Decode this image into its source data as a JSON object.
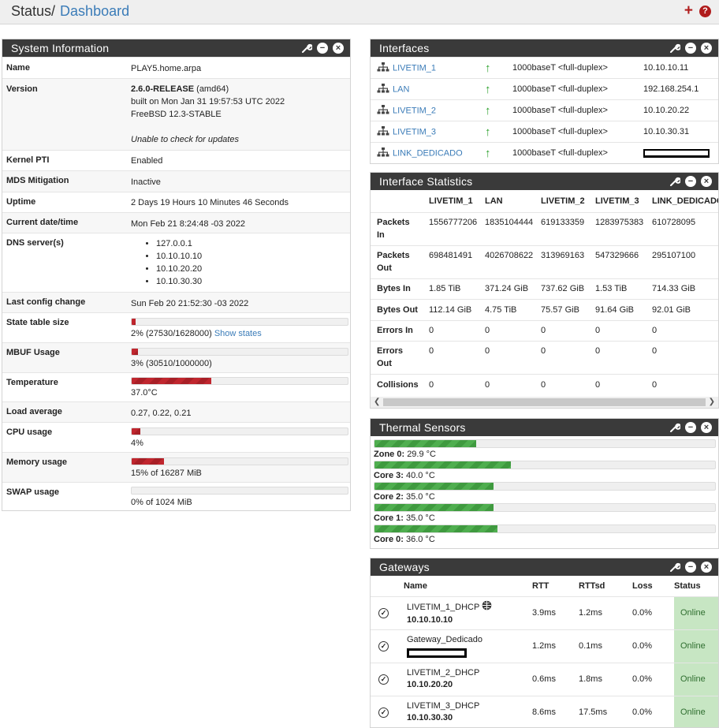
{
  "breadcrumb": {
    "section": "Status",
    "separator": "/",
    "page": "Dashboard"
  },
  "header_icons": [
    "plus-icon",
    "help-icon"
  ],
  "system_info": {
    "title": "System Information",
    "name_label": "Name",
    "name": "PLAY5.home.arpa",
    "version_label": "Version",
    "version_release": "2.6.0-RELEASE",
    "version_arch": " (amd64)",
    "version_built": "built on Mon Jan 31 19:57:53 UTC 2022",
    "version_os": "FreeBSD 12.3-STABLE",
    "version_update": "Unable to check for updates",
    "kernel_pti_label": "Kernel PTI",
    "kernel_pti": "Enabled",
    "mds_label": "MDS Mitigation",
    "mds": "Inactive",
    "uptime_label": "Uptime",
    "uptime": "2 Days 19 Hours 10 Minutes 46 Seconds",
    "datetime_label": "Current date/time",
    "datetime": "Mon Feb 21 8:24:48 -03 2022",
    "dns_label": "DNS server(s)",
    "dns": [
      "127.0.0.1",
      "10.10.10.10",
      "10.10.20.20",
      "10.10.30.30"
    ],
    "lastconfig_label": "Last config change",
    "lastconfig": "Sun Feb 20 21:52:30 -03 2022",
    "state_label": "State table size",
    "state_text": "2% (27530/1628000) ",
    "state_link": "Show states",
    "state_pct": 2,
    "mbuf_label": "MBUF Usage",
    "mbuf_text": "3% (30510/1000000)",
    "mbuf_pct": 3,
    "temp_label": "Temperature",
    "temp_text": "37.0°C",
    "temp_pct": 37,
    "load_label": "Load average",
    "load": "0.27, 0.22, 0.21",
    "cpu_label": "CPU usage",
    "cpu_text": "4%",
    "cpu_pct": 4,
    "mem_label": "Memory usage",
    "mem_text": "15% of 16287 MiB",
    "mem_pct": 15,
    "swap_label": "SWAP usage",
    "swap_text": "0% of 1024 MiB",
    "swap_pct": 0
  },
  "interfaces": {
    "title": "Interfaces",
    "rows": [
      {
        "name": "LIVETIM_1",
        "media": "1000baseT <full-duplex>",
        "ip": "10.10.10.11"
      },
      {
        "name": "LAN",
        "media": "1000baseT <full-duplex>",
        "ip": "192.168.254.1"
      },
      {
        "name": "LIVETIM_2",
        "media": "1000baseT <full-duplex>",
        "ip": "10.10.20.22"
      },
      {
        "name": "LIVETIM_3",
        "media": "1000baseT <full-duplex>",
        "ip": "10.10.30.31"
      },
      {
        "name": "LINK_DEDICADO",
        "media": "1000baseT <full-duplex>",
        "ip": ""
      }
    ]
  },
  "interface_stats": {
    "title": "Interface Statistics",
    "columns": [
      "LIVETIM_1",
      "LAN",
      "LIVETIM_2",
      "LIVETIM_3",
      "LINK_DEDICADO"
    ],
    "rows": [
      {
        "label1": "Packets",
        "label2": "In",
        "values": [
          "1556777206",
          "1835104444",
          "619133359",
          "1283975383",
          "610728095"
        ]
      },
      {
        "label1": "Packets",
        "label2": "Out",
        "values": [
          "698481491",
          "4026708622",
          "313969163",
          "547329666",
          "295107100"
        ]
      },
      {
        "label1": "Bytes In",
        "label2": "",
        "values": [
          "1.85 TiB",
          "371.24 GiB",
          "737.62 GiB",
          "1.53 TiB",
          "714.33 GiB"
        ]
      },
      {
        "label1": "Bytes Out",
        "label2": "",
        "values": [
          "112.14 GiB",
          "4.75 TiB",
          "75.57 GiB",
          "91.64 GiB",
          "92.01 GiB"
        ]
      },
      {
        "label1": "Errors In",
        "label2": "",
        "values": [
          "0",
          "0",
          "0",
          "0",
          "0"
        ]
      },
      {
        "label1": "Errors",
        "label2": "Out",
        "values": [
          "0",
          "0",
          "0",
          "0",
          "0"
        ]
      },
      {
        "label1": "Collisions",
        "label2": "",
        "values": [
          "0",
          "0",
          "0",
          "0",
          "0"
        ]
      }
    ]
  },
  "thermal": {
    "title": "Thermal Sensors",
    "sensors": [
      {
        "label": "Zone 0:",
        "value": "29.9 °C",
        "temp": 29.9
      },
      {
        "label": "Core 3:",
        "value": "40.0 °C",
        "temp": 40.0
      },
      {
        "label": "Core 2:",
        "value": "35.0 °C",
        "temp": 35.0
      },
      {
        "label": "Core 1:",
        "value": "35.0 °C",
        "temp": 35.0
      },
      {
        "label": "Core 0:",
        "value": "36.0 °C",
        "temp": 36.0
      }
    ]
  },
  "gateways": {
    "title": "Gateways",
    "headers": {
      "name": "Name",
      "rtt": "RTT",
      "rttsd": "RTTsd",
      "loss": "Loss",
      "status": "Status"
    },
    "rows": [
      {
        "name": "LIVETIM_1_DHCP",
        "ip": "10.10.10.10",
        "rtt": "3.9ms",
        "rttsd": "1.2ms",
        "loss": "0.0%",
        "status": "Online"
      },
      {
        "name": "Gateway_Dedicado",
        "ip": "",
        "rtt": "1.2ms",
        "rttsd": "0.1ms",
        "loss": "0.0%",
        "status": "Online"
      },
      {
        "name": "LIVETIM_2_DHCP",
        "ip": "10.10.20.20",
        "rtt": "0.6ms",
        "rttsd": "1.8ms",
        "loss": "0.0%",
        "status": "Online"
      },
      {
        "name": "LIVETIM_3_DHCP",
        "ip": "10.10.30.30",
        "rtt": "8.6ms",
        "rttsd": "17.5ms",
        "loss": "0.0%",
        "status": "Online"
      }
    ]
  }
}
